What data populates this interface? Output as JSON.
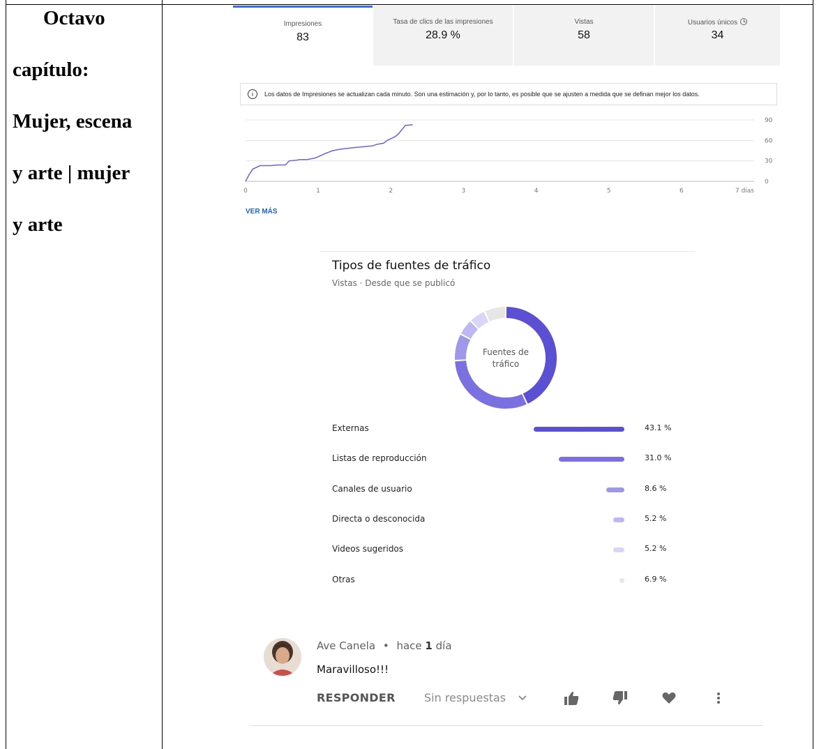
{
  "doc": {
    "title_lines": [
      "Octavo",
      "capítulo:",
      "Mujer, escena",
      "y arte | mujer",
      "y arte"
    ]
  },
  "metrics": [
    {
      "label": "Impresiones",
      "value": "83",
      "active": true
    },
    {
      "label": "Tasa de clics de las impresiones",
      "value": "28.9 %",
      "active": false
    },
    {
      "label": "Vistas",
      "value": "58",
      "active": false
    },
    {
      "label": "Usuarios únicos",
      "value": "34",
      "active": false,
      "icon": "clock-icon"
    }
  ],
  "notice": {
    "icon": "info-icon",
    "text": "Los datos de Impresiones se actualizan cada minuto. Son una estimación y, por lo tanto, es posible que se ajusten a medida que se definan mejor los datos."
  },
  "chart_data": {
    "type": "line",
    "x_ticks": [
      "0",
      "1",
      "2",
      "3",
      "4",
      "5",
      "6",
      "7 días"
    ],
    "y_ticks": [
      "0",
      "30",
      "60",
      "90"
    ],
    "ylim": [
      0,
      90
    ],
    "xlim": [
      0,
      7
    ],
    "grid": true,
    "color": "#6a62d6",
    "x": [
      0,
      0.05,
      0.1,
      0.2,
      0.35,
      0.45,
      0.55,
      0.6,
      0.7,
      0.75,
      0.85,
      0.95,
      1.0,
      1.1,
      1.2,
      1.3,
      1.45,
      1.55,
      1.65,
      1.75,
      1.8,
      1.9,
      1.95,
      2.05,
      2.1,
      2.2,
      2.3
    ],
    "y": [
      0,
      10,
      18,
      23,
      23,
      24,
      24,
      30,
      31,
      32,
      32,
      34,
      36,
      41,
      45,
      47,
      49,
      50,
      51,
      52,
      54,
      56,
      60,
      65,
      69,
      82,
      83
    ]
  },
  "see_more": "VER MÁS",
  "traffic": {
    "title": "Tipos de fuentes de tráfico",
    "subtitle": "Vistas · Desde que se publicó",
    "donut_label": [
      "Fuentes de",
      "tráfico"
    ],
    "sources": [
      {
        "name": "Externas",
        "pct": "43.1 %",
        "value": 43.1,
        "color": "#5b4fd4"
      },
      {
        "name": "Listas de reproducción",
        "pct": "31.0 %",
        "value": 31.0,
        "color": "#7b70e0"
      },
      {
        "name": "Canales de usuario",
        "pct": "8.6 %",
        "value": 8.6,
        "color": "#9f97ea"
      },
      {
        "name": "Directa o desconocida",
        "pct": "5.2 %",
        "value": 5.2,
        "color": "#bdb8f2"
      },
      {
        "name": "Videos sugeridos",
        "pct": "5.2 %",
        "value": 5.2,
        "color": "#d8d5f7"
      },
      {
        "name": "Otras",
        "pct": "6.9 %",
        "value": 6.9,
        "color": "#e6e6e6"
      }
    ]
  },
  "comment": {
    "author": "Ave Canela",
    "sep": "•",
    "time_prefix": "hace",
    "time_num": "1",
    "time_unit": "día",
    "text": "Maravilloso!!!",
    "reply": "RESPONDER",
    "no_replies": "Sin respuestas",
    "icons": [
      "chevron-down-icon",
      "thumbs-up-icon",
      "thumbs-down-icon",
      "heart-icon",
      "more-vert-icon"
    ]
  }
}
